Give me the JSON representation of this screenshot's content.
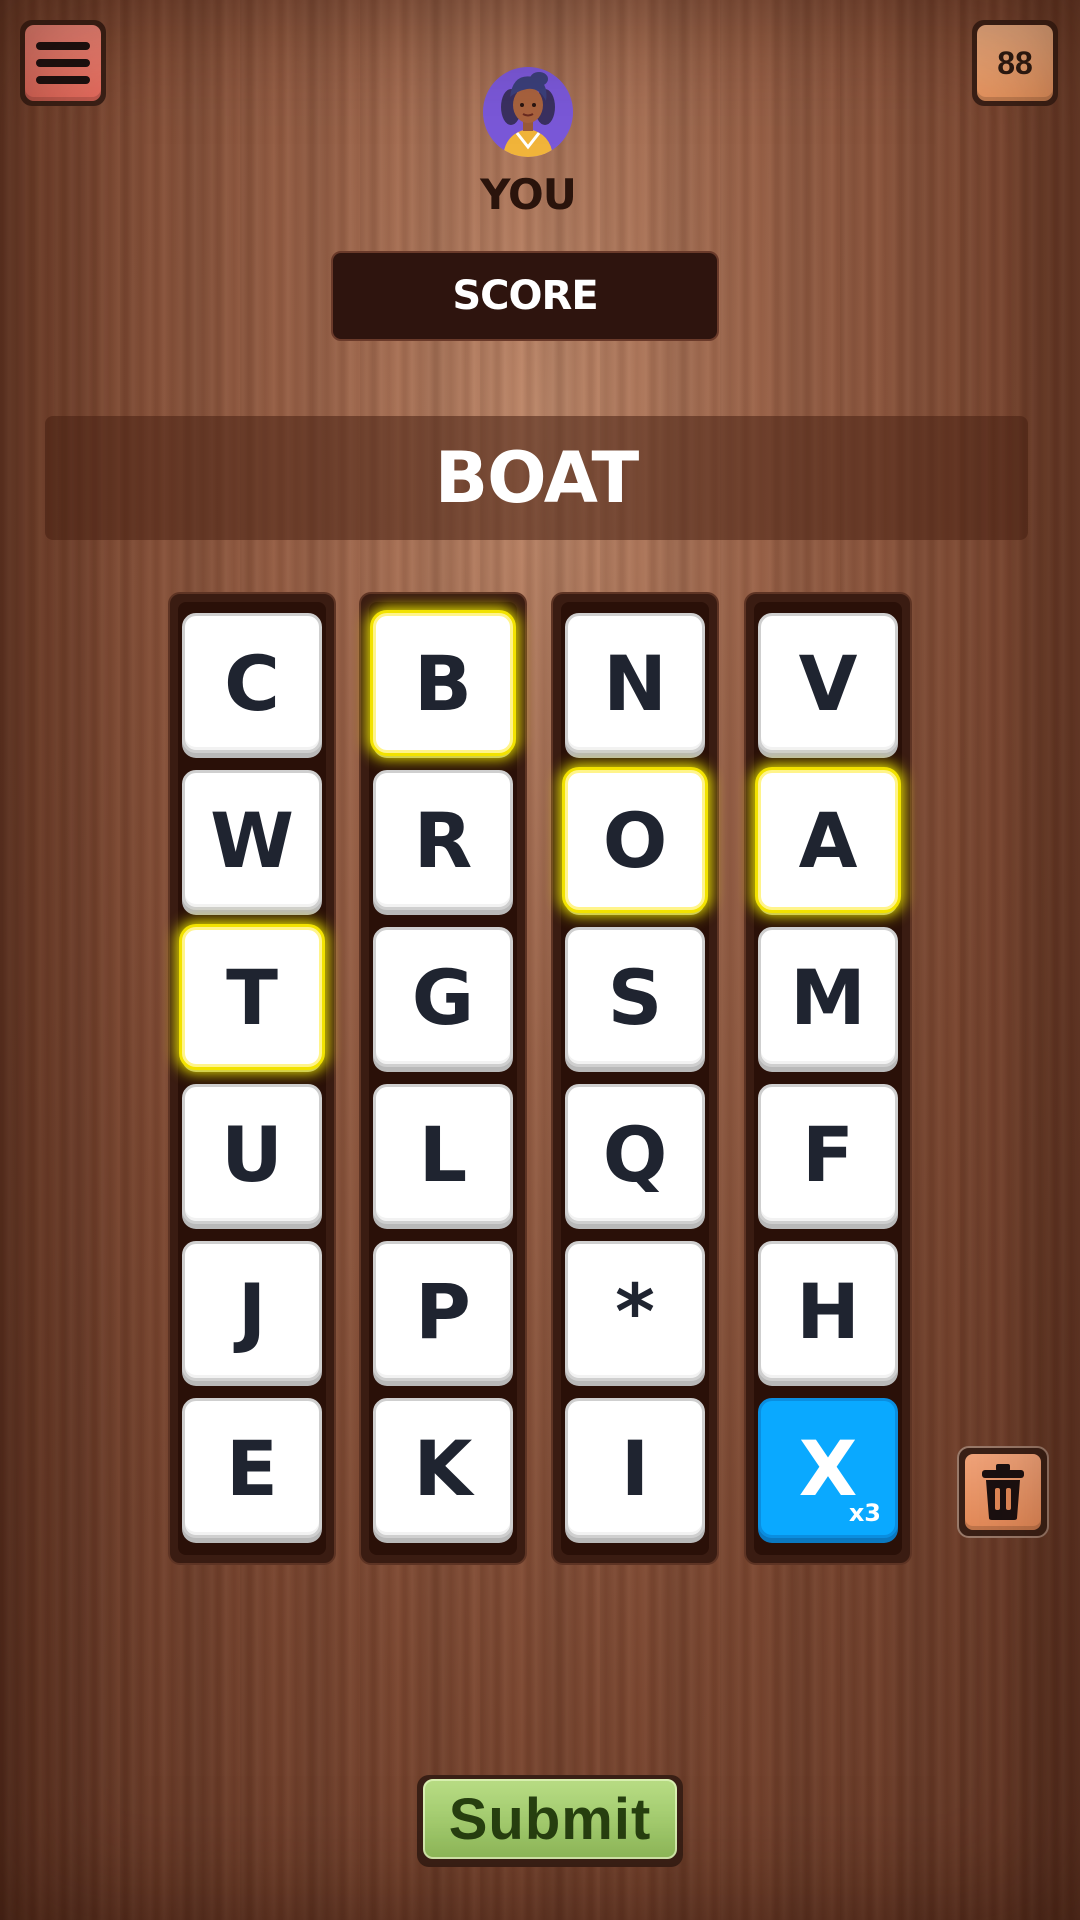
{
  "header": {
    "counter_value": "88",
    "icons": {
      "menu": "hamburger-menu-icon",
      "trash": "trash-icon"
    }
  },
  "player": {
    "name": "YOU",
    "avatar_icon": "player-avatar"
  },
  "score": {
    "label": "SCORE"
  },
  "current_word": "BOAT",
  "board": {
    "columns": [
      [
        {
          "letter": "C"
        },
        {
          "letter": "W"
        },
        {
          "letter": "T",
          "selected": true
        },
        {
          "letter": "U"
        },
        {
          "letter": "J"
        },
        {
          "letter": "E"
        }
      ],
      [
        {
          "letter": "B",
          "selected": true
        },
        {
          "letter": "R"
        },
        {
          "letter": "G"
        },
        {
          "letter": "L"
        },
        {
          "letter": "P"
        },
        {
          "letter": "K"
        }
      ],
      [
        {
          "letter": "N"
        },
        {
          "letter": "O",
          "selected": true
        },
        {
          "letter": "S"
        },
        {
          "letter": "Q"
        },
        {
          "letter": "*"
        },
        {
          "letter": "I"
        }
      ],
      [
        {
          "letter": "V"
        },
        {
          "letter": "A",
          "selected": true
        },
        {
          "letter": "M"
        },
        {
          "letter": "F"
        },
        {
          "letter": "H"
        },
        {
          "letter": "X",
          "special": true,
          "multiplier": "x3"
        }
      ]
    ],
    "colors": {
      "selected_glow": "#f2e200",
      "special_tile": "#0aa9ff"
    }
  },
  "actions": {
    "submit_label": "Submit"
  }
}
